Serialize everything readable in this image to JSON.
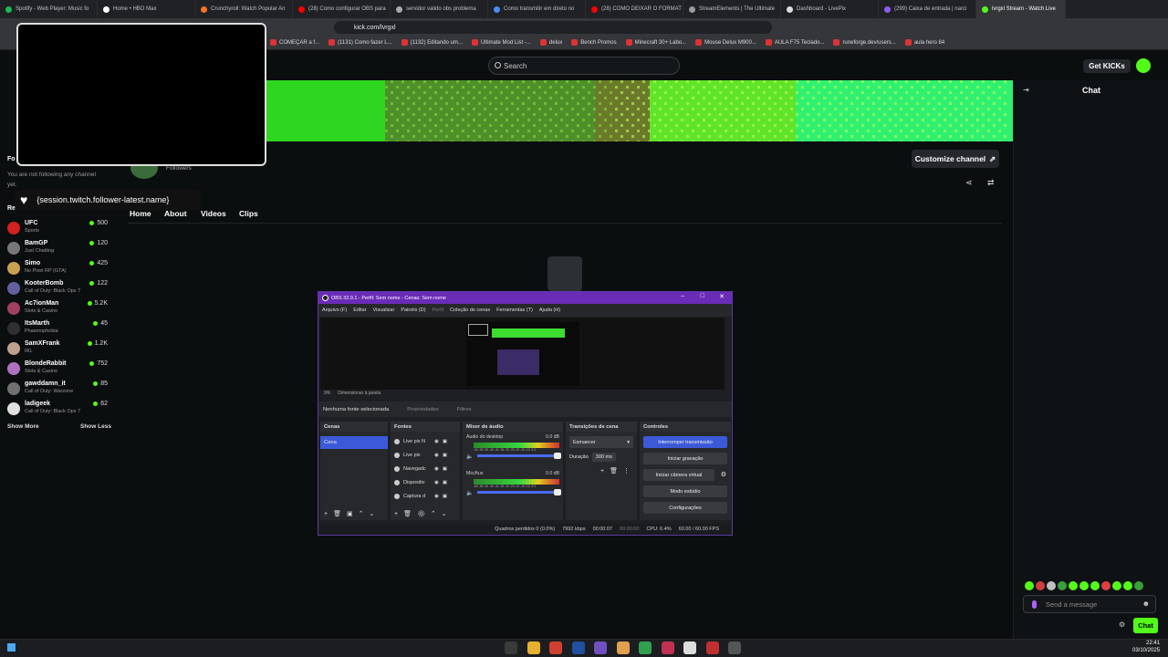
{
  "browser": {
    "tabs": [
      {
        "label": "Spotify - Web Player: Music fo",
        "color": "#1db954"
      },
      {
        "label": "Home • HBO Max",
        "color": "#ffffff"
      },
      {
        "label": "Crunchyroll: Watch Popular An",
        "color": "#f47521"
      },
      {
        "label": "(28) Como configurar OBS para",
        "color": "#ff0000"
      },
      {
        "label": "servidor valido obs problema",
        "color": "#aaaaaa"
      },
      {
        "label": "Como transmitir em direto no",
        "color": "#4a8df8"
      },
      {
        "label": "(28) COMO DEIXAR O FORMAT",
        "color": "#ff0000"
      },
      {
        "label": "StreamElements | The Ultimate",
        "color": "#9b9b9b"
      },
      {
        "label": "Dashboard - LivePix",
        "color": "#dddddd"
      },
      {
        "label": "(299) Caixa de entrada | narci",
        "color": "#8e5cf7"
      },
      {
        "label": "lvrgxl Stream - Watch Live",
        "color": "#53fc18"
      }
    ],
    "url": "kick.com/lvrgxl",
    "bookmarks": [
      "COMEÇAR a f...",
      "(1131) Como fazer L...",
      "(1132) Editando um...",
      "Ultimate Mod List -...",
      "delux",
      "Bench Promos",
      "Minecraft 30+ Labo...",
      "Mouse Delux M900...",
      "AULA F75 Teclado...",
      "runeforge.dev/users...",
      "aula hero 84"
    ]
  },
  "kick": {
    "search_placeholder": "Search",
    "get_kicks": "Get KICKs",
    "chat_label": "Chat",
    "customize_channel": "Customize channel",
    "followers_label": "Followers",
    "nav_tabs": [
      "Home",
      "About",
      "Videos",
      "Clips"
    ],
    "sidebar": {
      "following_header": "Fo",
      "not_following": "You are not following any channel yet.",
      "recommended_header": "Re",
      "channels": [
        {
          "name": "UFC",
          "category": "Sports",
          "viewers": "500",
          "color": "#d32020"
        },
        {
          "name": "BamGP",
          "category": "Just Chatting",
          "viewers": "120",
          "color": "#777777"
        },
        {
          "name": "Simo",
          "category": "No Pixel RP (GTA)",
          "viewers": "425",
          "color": "#c8a050"
        },
        {
          "name": "KooterBomb",
          "category": "Call of Duty: Black Ops 7",
          "viewers": "122",
          "color": "#6060a0"
        },
        {
          "name": "Ac7ionMan",
          "category": "Slots & Casino",
          "viewers": "5.2K",
          "color": "#a04060"
        },
        {
          "name": "ItsMarth",
          "category": "Phasmophobia",
          "viewers": "45",
          "color": "#303030"
        },
        {
          "name": "SamXFrank",
          "category": "IRL",
          "viewers": "1.2K",
          "color": "#c0a090"
        },
        {
          "name": "BlondeRabbit",
          "category": "Slots & Casino",
          "viewers": "752",
          "color": "#b070c0"
        },
        {
          "name": "gawddamn_it",
          "category": "Call of Duty: Warzone",
          "viewers": "85",
          "color": "#707070"
        },
        {
          "name": "ladigeek",
          "category": "Call of Duty: Black Ops 7",
          "viewers": "62",
          "color": "#e0e0e0"
        }
      ],
      "show_more": "Show More",
      "show_less": "Show Less"
    },
    "send_message_placeholder": "Send a message",
    "chat_button": "Chat"
  },
  "overlay": {
    "follower_text": "{session.twitch.follower-latest.name}"
  },
  "obs": {
    "title": "OBS 32.0.1 - Perfil: Sem nome - Cenas: Sem nome",
    "menu": [
      "Arquivo (F)",
      "Editar",
      "Visualizar",
      "Painéis (D)",
      "Perfil",
      "Coleção de cenas",
      "Ferramentas (T)",
      "Ajuda (H)"
    ],
    "zoom_label": "9%",
    "resize_label": "Dimensionar à janela",
    "no_source": "Nenhuma fonte selecionada",
    "properties": "Propriedades",
    "filters": "Filtros",
    "docks": {
      "scenes": "Cenas",
      "sources": "Fontes",
      "mixer": "Mixer de áudio",
      "transitions": "Transições de cena",
      "controls": "Controles"
    },
    "scene_item": "Cena",
    "sources": [
      "Live pix N",
      "Live pix",
      "Navegadc",
      "Dispositiv",
      "Captura d"
    ],
    "mixer": [
      {
        "name": "Áudio do desktop",
        "db": "0.0 dB"
      },
      {
        "name": "Mic/Aux",
        "db": "0.0 dB"
      }
    ],
    "mixer_scale": "-60 -55 -50 -45 -40 -35 -30 -25 -20 -15 -10 -5 0",
    "transition": "Esmaecer",
    "duration_label": "Duração",
    "duration_value": "300 ms",
    "controls": [
      "Interromper transmissão",
      "Iniciar gravação",
      "Iniciar câmera virtual",
      "Modo estúdio",
      "Configurações"
    ],
    "status": {
      "dropped": "Quadros perdidos 0 (0.0%)",
      "bitrate": "7992 kbps",
      "stream_time": "00:00:07",
      "rec_time": "00:00:00",
      "cpu": "CPU: 6.4%",
      "fps": "60.00 / 60.00 FPS"
    }
  },
  "taskbar": {
    "time": "22:41",
    "date": "03/10/2025"
  },
  "colors": {
    "kick_green": "#53fc18",
    "obs_purple": "#6a2bb6",
    "obs_accent": "#3c5ad8"
  }
}
